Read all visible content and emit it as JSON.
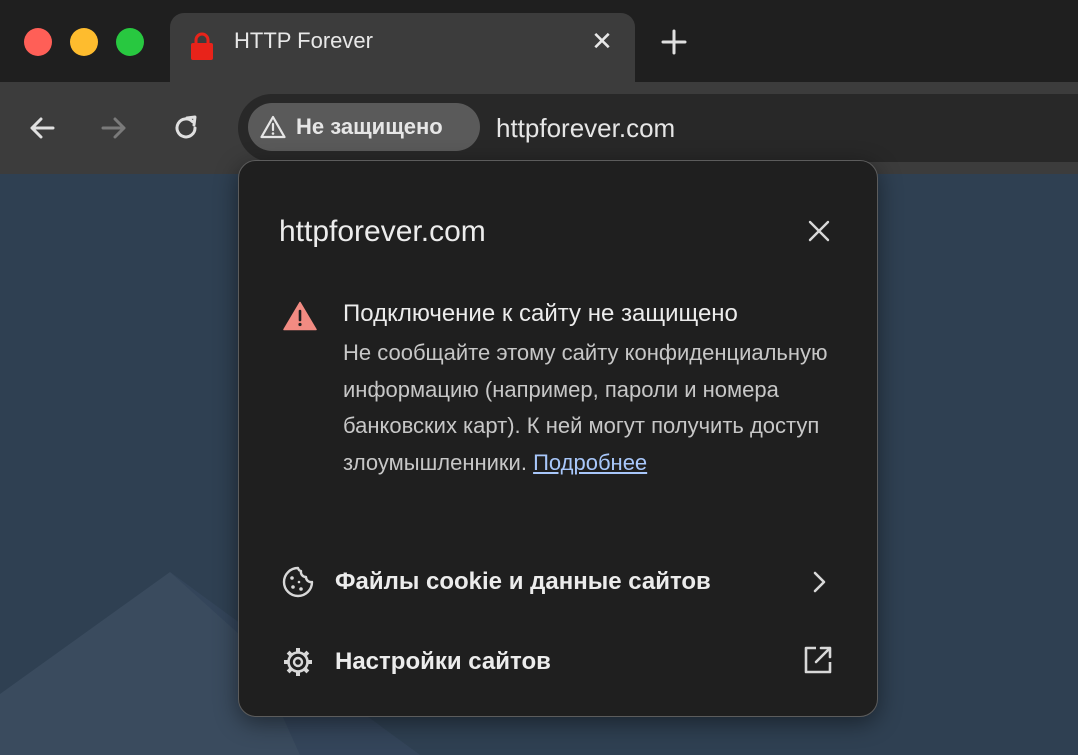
{
  "tab": {
    "title": "HTTP Forever",
    "close_glyph": "✕"
  },
  "toolbar": {
    "security_chip_label": "Не защищено",
    "url": "httpforever.com"
  },
  "popup": {
    "title": "httpforever.com",
    "warning_heading": "Подключение к сайту не защищено",
    "warning_body": "Не сообщайте этому сайту конфиденциальную информацию (например, пароли и номера банковских карт). К ней могут получить доступ злоумышленники.",
    "learn_more_link": "Подробнее",
    "rows": [
      {
        "label": "Файлы cookie и данные сайтов",
        "icon": "cookie-icon",
        "trailing_icon": "chevron-right-icon"
      },
      {
        "label": "Настройки сайтов",
        "icon": "gear-icon",
        "trailing_icon": "external-link-icon"
      }
    ]
  },
  "colors": {
    "warning_red": "#f28b82",
    "link_blue": "#a8c7fa",
    "favicon_red": "#e8231a"
  }
}
